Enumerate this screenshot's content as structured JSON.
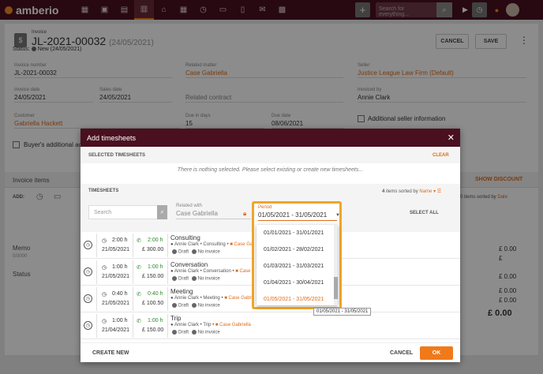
{
  "topbar": {
    "logo": "amberio",
    "nav_icons": [
      "dashboard-icon",
      "contacts-icon",
      "briefcase-icon",
      "invoice-icon",
      "bank-icon",
      "calendar-icon",
      "history-icon",
      "folder-icon",
      "documents-icon",
      "mail-icon",
      "reports-icon"
    ],
    "search_placeholder": "Search for everything..."
  },
  "invoice": {
    "kicker": "Invoice",
    "number": "JL-2021-00032",
    "date_paren": "(24/05/2021)",
    "status_label": "Status:",
    "status_value": "New (24/05/2021)",
    "cancel_label": "CANCEL",
    "save_label": "SAVE"
  },
  "fields": {
    "invoice_number_label": "Invoice number",
    "invoice_number": "JL-2021-00032",
    "related_matter_label": "Related matter",
    "related_matter": "Case Gabriella",
    "seller_label": "Seller",
    "seller": "Justice League Law Firm (Default)",
    "invoice_date_label": "Invoice date",
    "invoice_date": "24/05/2021",
    "sales_date_label": "Sales date",
    "sales_date": "24/05/2021",
    "related_contract_placeholder": "Related contract",
    "invoiced_by_label": "Invoiced by",
    "invoiced_by": "Annie Clark",
    "customer_label": "Customer",
    "customer": "Gabriella Hackett",
    "due_in_days_label": "Due in days",
    "due_in_days": "15",
    "due_date_label": "Due date",
    "due_date": "08/06/2021",
    "additional_seller_info": "Additional seller information",
    "buyers_additional": "Buyer's additional ac",
    "invoice_items": "Invoice items",
    "show_discount": "SHOW DISCOUNT",
    "add_label": "ADD:",
    "right_items_sorted": "0 items sorted by",
    "right_sort": "Date",
    "memo_label": "Memo",
    "memo_counter": "0/3000",
    "status_label": "Status",
    "amt1": "£ 0.00",
    "amt2": "£",
    "amt3": "£ 0.00",
    "amt4": "£ 0.00",
    "amt5": "£ 0.00",
    "total": "£ 0.00"
  },
  "modal": {
    "title": "Add timesheets",
    "selected_title": "SELECTED TIMESHEETS",
    "clear_label": "CLEAR",
    "empty_message": "There is nothing selected. Please select existing or create new timesheets...",
    "timesheets_title": "TIMESHEETS",
    "items_count": "4",
    "items_sorted_by": "items sorted by",
    "sort_field": "Name",
    "search_placeholder": "Search",
    "related_with_label": "Related with",
    "related_with": "Case Gabriella",
    "period_label": "Period",
    "period_value": "01/05/2021 - 31/05/2021",
    "period_options": [
      "01/01/2021 - 31/01/2021",
      "01/02/2021 - 28/02/2021",
      "01/03/2021 - 31/03/2021",
      "01/04/2021 - 30/04/2021",
      "01/05/2021 - 31/05/2021"
    ],
    "tooltip": "01/05/2021 - 31/05/2021",
    "select_all": "SELECT ALL",
    "rows": [
      {
        "hours": "2:00 h",
        "date": "21/05/2021",
        "billed": "2:00 h",
        "amount": "£ 300.00",
        "title": "Consulting",
        "user": "Annie Clark",
        "activity": "Consulting",
        "matter": "Case Gabriell",
        "draft": "Draft",
        "invoice": "No invoice"
      },
      {
        "hours": "1:00 h",
        "date": "21/05/2021",
        "billed": "1:00 h",
        "amount": "£ 150.00",
        "title": "Conversation",
        "user": "Annie Clark",
        "activity": "Conversation",
        "matter": "Case Ga",
        "draft": "Draft",
        "invoice": "No invoice"
      },
      {
        "hours": "0:40 h",
        "date": "21/05/2021",
        "billed": "0:40 h",
        "amount": "£ 100.50",
        "title": "Meeting",
        "user": "Annie Clark",
        "activity": "Meeting",
        "matter": "Case Gabriella",
        "draft": "Draft",
        "invoice": "No invoice"
      },
      {
        "hours": "1:00 h",
        "date": "21/04/2021",
        "billed": "1:00 h",
        "amount": "£ 150.00",
        "title": "Trip",
        "user": "Annie Clark",
        "activity": "Trip",
        "matter": "Case Gabriella",
        "draft": "Draft",
        "invoice": "No invoice"
      }
    ],
    "create_new": "CREATE NEW",
    "cancel": "CANCEL",
    "ok": "OK"
  },
  "colors": {
    "brand": "#4a1020",
    "accent": "#f07a1a",
    "highlight": "#f0a52a"
  }
}
